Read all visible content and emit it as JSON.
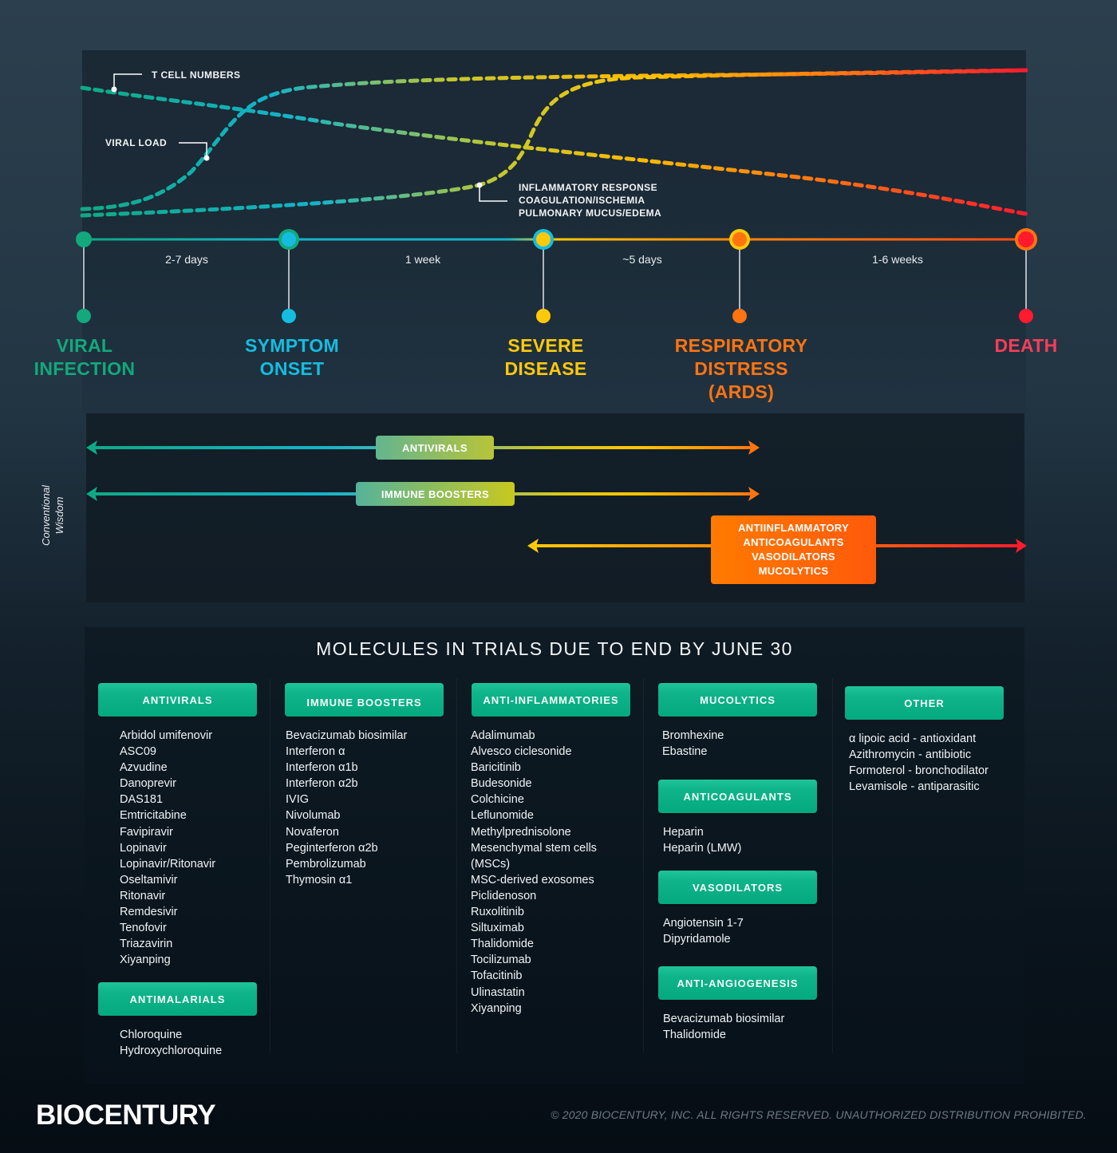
{
  "curves": {
    "labels": {
      "t_cell": "T CELL NUMBERS",
      "viral_load": "VIRAL LOAD",
      "inflammatory": [
        "INFLAMMATORY RESPONSE",
        "COAGULATION/ISCHEMIA",
        "PULMONARY MUCUS/EDEMA"
      ]
    }
  },
  "timeline": {
    "stages": [
      {
        "title_lines": [
          "VIRAL",
          "INFECTION"
        ],
        "color": "#12a97d"
      },
      {
        "title_lines": [
          "SYMPTOM",
          "ONSET"
        ],
        "color": "#14bde0"
      },
      {
        "title_lines": [
          "SEVERE",
          "DISEASE"
        ],
        "color": "#ffc90a"
      },
      {
        "title_lines": [
          "RESPIRATORY",
          "DISTRESS",
          "(ARDS)"
        ],
        "color": "#ff7410"
      },
      {
        "title_lines": [
          "DEATH"
        ],
        "color": "#f93d5a"
      }
    ],
    "intervals": [
      "2-7 days",
      "1 week",
      "~5 days",
      "1-6 weeks"
    ]
  },
  "conventional_wisdom": {
    "side_label_lines": [
      "Conventional",
      "Wisdom"
    ],
    "arrows": [
      {
        "label": "ANTIVIRALS"
      },
      {
        "label": "IMMUNE BOOSTERS"
      }
    ],
    "late_box_lines": [
      "ANTIINFLAMMATORY",
      "ANTICOAGULANTS",
      "VASODILATORS",
      "MUCOLYTICS"
    ]
  },
  "molecules": {
    "title": "MOLECULES IN TRIALS DUE TO END BY JUNE 30",
    "categories": [
      {
        "name": "ANTIVIRALS",
        "items": [
          "Arbidol umifenovir",
          "ASC09",
          "Azvudine",
          "Danoprevir",
          "DAS181",
          "Emtricitabine",
          "Favipiravir",
          "Lopinavir",
          "Lopinavir/Ritonavir",
          "Oseltamivir",
          "Ritonavir",
          "Remdesivir",
          "Tenofovir",
          "Triazavirin",
          "Xiyanping"
        ]
      },
      {
        "name": "ANTIMALARIALS",
        "items": [
          "Chloroquine",
          "Hydroxychloroquine"
        ]
      },
      {
        "name": "IMMUNE BOOSTERS",
        "items": [
          "Bevacizumab biosimilar",
          "Interferon α",
          "Interferon α1b",
          "Interferon α2b",
          "IVIG",
          "Nivolumab",
          "Novaferon",
          "Peginterferon α2b",
          "Pembrolizumab",
          "Thymosin α1"
        ]
      },
      {
        "name": "ANTI-INFLAMMATORIES",
        "items": [
          "Adalimumab",
          "Alvesco ciclesonide",
          "Baricitinib",
          "Budesonide",
          "Colchicine",
          "Leflunomide",
          "Methylprednisolone",
          "Mesenchymal stem cells",
          "(MSCs)",
          "MSC-derived exosomes",
          "Piclidenoson",
          "Ruxolitinib",
          "Siltuximab",
          "Thalidomide",
          "Tocilizumab",
          "Tofacitinib",
          "Ulinastatin",
          "Xiyanping"
        ]
      },
      {
        "name": "MUCOLYTICS",
        "items": [
          "Bromhexine",
          "Ebastine"
        ]
      },
      {
        "name": "ANTICOAGULANTS",
        "items": [
          "Heparin",
          "Heparin (LMW)"
        ]
      },
      {
        "name": "VASODILATORS",
        "items": [
          "Angiotensin 1-7",
          "Dipyridamole"
        ]
      },
      {
        "name": "ANTI-ANGIOGENESIS",
        "items": [
          "Bevacizumab biosimilar",
          "Thalidomide"
        ]
      },
      {
        "name": "OTHER",
        "items": [
          "α lipoic acid - antioxidant",
          "Azithromycin - antibiotic",
          "Formoterol - bronchodilator",
          "Levamisole - antiparasitic"
        ]
      }
    ]
  },
  "footer": {
    "logo": "BIOCENTURY",
    "copyright": "© 2020 BIOCENTURY, INC. ALL RIGHTS RESERVED. UNAUTHORIZED DISTRIBUTION PROHIBITED."
  }
}
